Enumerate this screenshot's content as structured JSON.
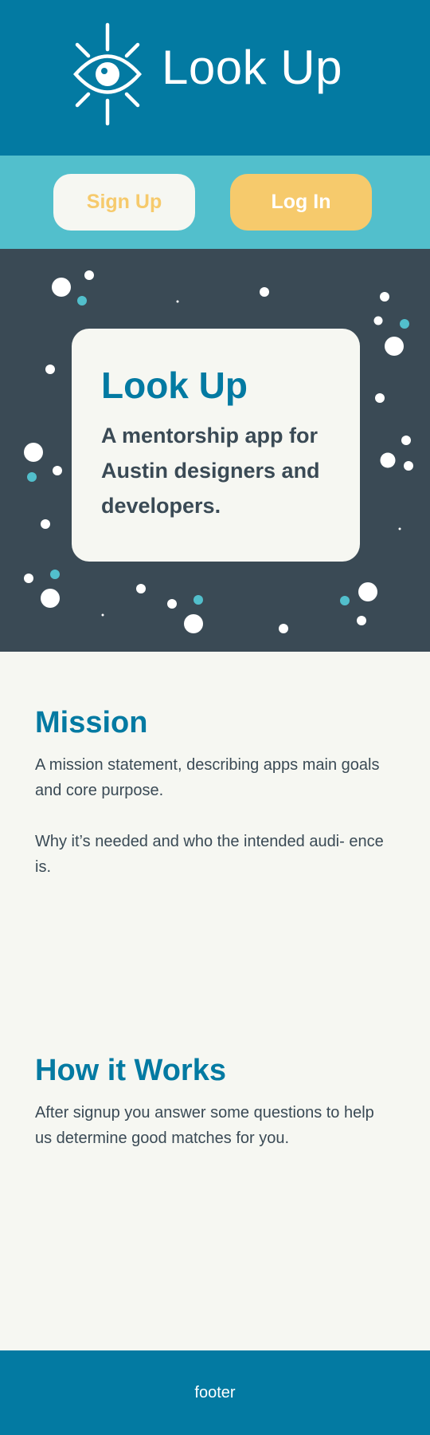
{
  "colors": {
    "brand_blue": "#037aa2",
    "teal": "#52bfcc",
    "yellow": "#f6ca6c",
    "slate": "#3a4a55",
    "cream": "#f6f7f2"
  },
  "header": {
    "logo_icon": "eye-icon",
    "app_name": "Look Up"
  },
  "auth": {
    "signup_label": "Sign Up",
    "login_label": "Log In"
  },
  "hero": {
    "title": "Look Up",
    "subtitle": "A mentorship app for Austin designers and developers."
  },
  "mission": {
    "title": "Mission",
    "paragraph_1": "A mission statement, describing apps main goals and core purpose.",
    "paragraph_2": "Why it’s needed and who the intended audi- ence is."
  },
  "how_it_works": {
    "title": "How it Works",
    "paragraph": "After signup you answer some questions to help us determine good matches for you."
  },
  "footer": {
    "text": "footer"
  }
}
